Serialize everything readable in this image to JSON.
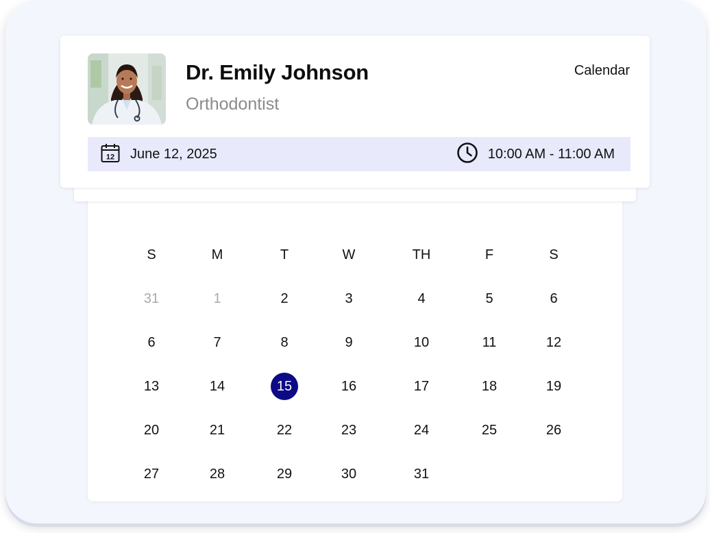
{
  "doctor": {
    "name": "Dr. Emily Johnson",
    "specialty": "Orthodontist",
    "calendar_link": "Calendar"
  },
  "appointment": {
    "date": "June 12, 2025",
    "date_icon_day": "12",
    "date_icon": "calendar-icon",
    "time": "10:00 AM - 11:00 AM",
    "time_icon": "clock-icon"
  },
  "calendar": {
    "weekdays": [
      "S",
      "M",
      "T",
      "W",
      "TH",
      "F",
      "S"
    ],
    "weeks": [
      [
        {
          "d": "31",
          "muted": true
        },
        {
          "d": "1",
          "muted": true
        },
        {
          "d": "2"
        },
        {
          "d": "3"
        },
        {
          "d": "4"
        },
        {
          "d": "5"
        },
        {
          "d": "6"
        }
      ],
      [
        {
          "d": "6"
        },
        {
          "d": "7"
        },
        {
          "d": "8"
        },
        {
          "d": "9"
        },
        {
          "d": "10"
        },
        {
          "d": "11"
        },
        {
          "d": "12"
        }
      ],
      [
        {
          "d": "13"
        },
        {
          "d": "14"
        },
        {
          "d": "15",
          "selected": true
        },
        {
          "d": "16"
        },
        {
          "d": "17"
        },
        {
          "d": "18"
        },
        {
          "d": "19"
        }
      ],
      [
        {
          "d": "20"
        },
        {
          "d": "21"
        },
        {
          "d": "22"
        },
        {
          "d": "23"
        },
        {
          "d": "24"
        },
        {
          "d": "25"
        },
        {
          "d": "26"
        }
      ],
      [
        {
          "d": "27"
        },
        {
          "d": "28"
        },
        {
          "d": "29"
        },
        {
          "d": "30"
        },
        {
          "d": "31"
        }
      ]
    ],
    "selected_color": "#0d0a85",
    "muted_color": "#a9a9a9"
  },
  "colors": {
    "background": "#f4f6fd",
    "info_bar": "#e8e9fb",
    "text": "#111111",
    "subtext": "#8a8a8a"
  }
}
